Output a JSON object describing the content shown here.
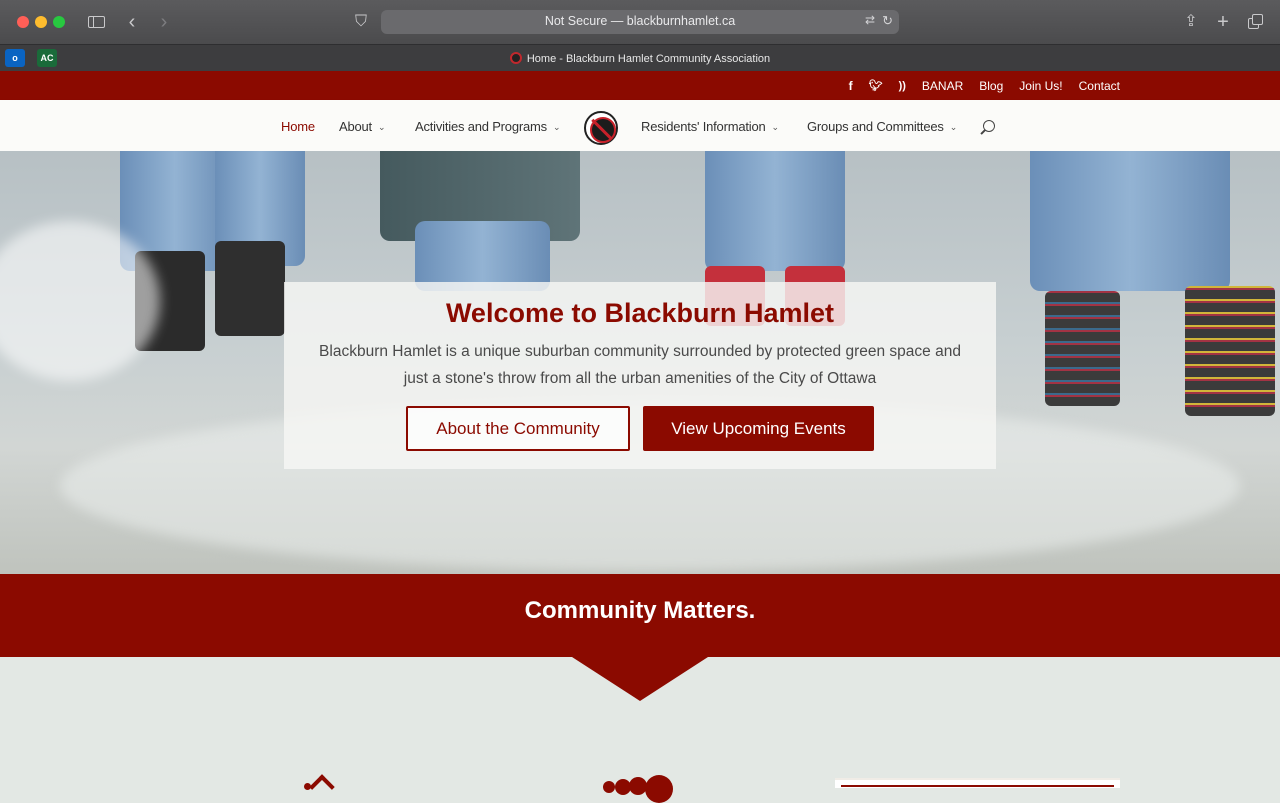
{
  "browser": {
    "url": "Not Secure — blackburnhamlet.ca",
    "tab_title": "Home - Blackburn Hamlet Community Association",
    "bookmarks": [
      {
        "icon": "outlook-icon",
        "label": "o"
      },
      {
        "icon": "acrobat-icon",
        "label": "AC"
      }
    ]
  },
  "topbar": {
    "social": [
      "f",
      "🐦",
      "rss"
    ],
    "links": [
      "BANAR",
      "Blog",
      "Join Us!",
      "Contact"
    ]
  },
  "nav": {
    "home": "Home",
    "about": "About",
    "activities": "Activities and Programs",
    "residents": "Residents' Information",
    "groups": "Groups and Committees"
  },
  "hero": {
    "title": "Welcome to Blackburn Hamlet",
    "text": "Blackburn Hamlet is a unique suburban community surrounded by protected green space and just a stone's throw from all the urban amenities of the City of Ottawa",
    "btn_about": "About the Community",
    "btn_events": "View Upcoming Events"
  },
  "banner": {
    "title": "Community Matters."
  },
  "colors": {
    "brand": "#8b0a00",
    "section_bg": "#e3e8e4"
  }
}
